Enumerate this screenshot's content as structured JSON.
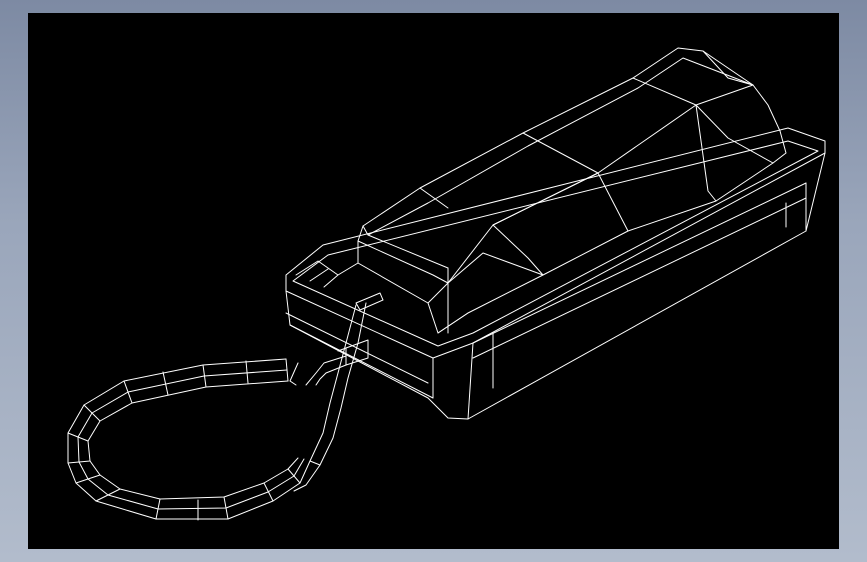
{
  "window": {
    "frame_color": "#8e9ab0",
    "viewport_color": "#000000",
    "line_color": "#ffffff"
  },
  "drawing": {
    "subject": "telephone-wireframe"
  }
}
